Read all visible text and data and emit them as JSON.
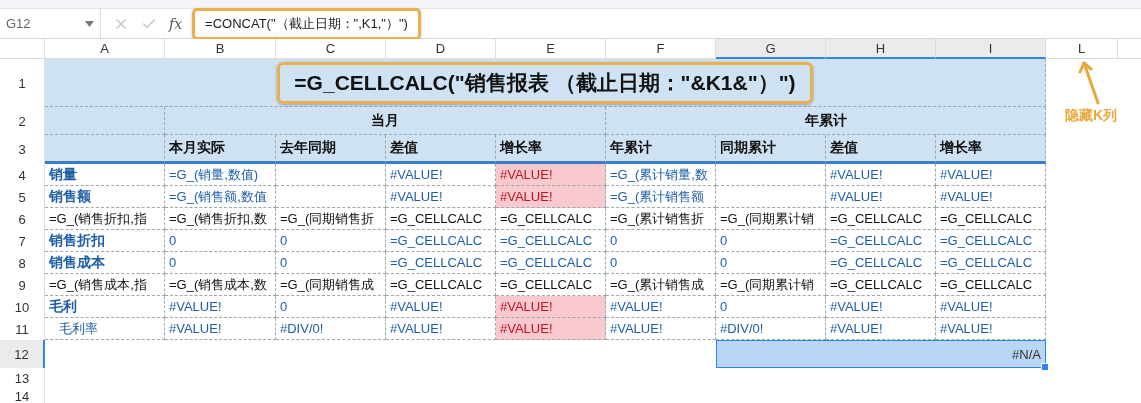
{
  "name_box": {
    "value": "G12"
  },
  "formula_bar": {
    "fx_label": "fx",
    "value": "=CONCAT(\"（截止日期：\",K1,\"）\")",
    "highlighted": true
  },
  "columns": [
    {
      "label": "A",
      "selected": false
    },
    {
      "label": "B",
      "selected": false
    },
    {
      "label": "C",
      "selected": false
    },
    {
      "label": "D",
      "selected": false
    },
    {
      "label": "E",
      "selected": false
    },
    {
      "label": "F",
      "selected": false
    },
    {
      "label": "G",
      "selected": true
    },
    {
      "label": "H",
      "selected": true
    },
    {
      "label": "I",
      "selected": true
    },
    {
      "label": "L",
      "selected": false
    }
  ],
  "row_labels": [
    {
      "label": "1",
      "selected": false
    },
    {
      "label": "2",
      "selected": false
    },
    {
      "label": "3",
      "selected": false
    },
    {
      "label": "4",
      "selected": false
    },
    {
      "label": "5",
      "selected": false
    },
    {
      "label": "6",
      "selected": false
    },
    {
      "label": "7",
      "selected": false
    },
    {
      "label": "8",
      "selected": false
    },
    {
      "label": "9",
      "selected": false
    },
    {
      "label": "10",
      "selected": false
    },
    {
      "label": "11",
      "selected": false
    },
    {
      "label": "12",
      "selected": true
    },
    {
      "label": "13",
      "selected": false
    },
    {
      "label": "14",
      "selected": false
    }
  ],
  "title": {
    "text": "=G_CELLCALC(\"销售报表 （截止日期：\"&K1&\"）\")",
    "highlighted": true
  },
  "groups": [
    {
      "label": "当月"
    },
    {
      "label": "年累计"
    }
  ],
  "subheaders": [
    "本月实际",
    "去年同期",
    "差值",
    "增长率",
    "年累计",
    "同期累计",
    "差值",
    "增长率"
  ],
  "rows": [
    {
      "cells": [
        {
          "text": "销量",
          "kind": "label"
        },
        {
          "text": "=G_(销量,数值)",
          "kind": "blue"
        },
        {
          "text": "",
          "kind": "blue"
        },
        {
          "text": "#VALUE!",
          "kind": "blue"
        },
        {
          "text": "#VALUE!",
          "kind": "error"
        },
        {
          "text": "=G_(累计销量,数",
          "kind": "blue"
        },
        {
          "text": "",
          "kind": "blue"
        },
        {
          "text": "#VALUE!",
          "kind": "blue"
        },
        {
          "text": "#VALUE!",
          "kind": "blue"
        }
      ]
    },
    {
      "cells": [
        {
          "text": "销售额",
          "kind": "label"
        },
        {
          "text": "=G_(销售额,数值",
          "kind": "blue"
        },
        {
          "text": "",
          "kind": "blue"
        },
        {
          "text": "#VALUE!",
          "kind": "blue"
        },
        {
          "text": "#VALUE!",
          "kind": "error"
        },
        {
          "text": "=G_(累计销售额",
          "kind": "blue"
        },
        {
          "text": "",
          "kind": "blue"
        },
        {
          "text": "#VALUE!",
          "kind": "blue"
        },
        {
          "text": "#VALUE!",
          "kind": "blue"
        }
      ]
    },
    {
      "cells": [
        {
          "text": "=G_(销售折扣,指",
          "kind": "black"
        },
        {
          "text": "=G_(销售折扣,数",
          "kind": "black"
        },
        {
          "text": "=G_(同期销售折",
          "kind": "black"
        },
        {
          "text": "=G_CELLCALC",
          "kind": "black"
        },
        {
          "text": "=G_CELLCALC",
          "kind": "black"
        },
        {
          "text": "=G_(累计销售折",
          "kind": "black"
        },
        {
          "text": "=G_(同期累计销",
          "kind": "black"
        },
        {
          "text": "=G_CELLCALC",
          "kind": "black"
        },
        {
          "text": "=G_CELLCALC",
          "kind": "black"
        }
      ]
    },
    {
      "cells": [
        {
          "text": "销售折扣",
          "kind": "label"
        },
        {
          "text": "0",
          "kind": "blue"
        },
        {
          "text": "0",
          "kind": "blue"
        },
        {
          "text": "=G_CELLCALC",
          "kind": "blue"
        },
        {
          "text": "=G_CELLCALC",
          "kind": "blue"
        },
        {
          "text": "0",
          "kind": "blue"
        },
        {
          "text": "0",
          "kind": "blue"
        },
        {
          "text": "=G_CELLCALC",
          "kind": "blue"
        },
        {
          "text": "=G_CELLCALC",
          "kind": "blue"
        }
      ]
    },
    {
      "cells": [
        {
          "text": "销售成本",
          "kind": "label"
        },
        {
          "text": "0",
          "kind": "blue"
        },
        {
          "text": "0",
          "kind": "blue"
        },
        {
          "text": "=G_CELLCALC",
          "kind": "blue"
        },
        {
          "text": "=G_CELLCALC",
          "kind": "blue"
        },
        {
          "text": "0",
          "kind": "blue"
        },
        {
          "text": "0",
          "kind": "blue"
        },
        {
          "text": "=G_CELLCALC",
          "kind": "blue"
        },
        {
          "text": "=G_CELLCALC",
          "kind": "blue"
        }
      ]
    },
    {
      "cells": [
        {
          "text": "=G_(销售成本,指",
          "kind": "black"
        },
        {
          "text": "=G_(销售成本,数",
          "kind": "black"
        },
        {
          "text": "=G_(同期销售成",
          "kind": "black"
        },
        {
          "text": "=G_CELLCALC",
          "kind": "black"
        },
        {
          "text": "=G_CELLCALC",
          "kind": "black"
        },
        {
          "text": "=G_(累计销售成",
          "kind": "black"
        },
        {
          "text": "=G_(同期累计销",
          "kind": "black"
        },
        {
          "text": "=G_CELLCALC",
          "kind": "black"
        },
        {
          "text": "=G_CELLCALC",
          "kind": "black"
        }
      ]
    },
    {
      "cells": [
        {
          "text": "毛利",
          "kind": "label"
        },
        {
          "text": "#VALUE!",
          "kind": "blue"
        },
        {
          "text": "0",
          "kind": "blue"
        },
        {
          "text": "#VALUE!",
          "kind": "blue"
        },
        {
          "text": "#VALUE!",
          "kind": "error"
        },
        {
          "text": "#VALUE!",
          "kind": "blue"
        },
        {
          "text": "0",
          "kind": "blue"
        },
        {
          "text": "#VALUE!",
          "kind": "blue"
        },
        {
          "text": "#VALUE!",
          "kind": "blue"
        }
      ]
    },
    {
      "cells": [
        {
          "text": "毛利率",
          "kind": "sublabel"
        },
        {
          "text": "#VALUE!",
          "kind": "blue"
        },
        {
          "text": "#DIV/0!",
          "kind": "blue"
        },
        {
          "text": "#VALUE!",
          "kind": "blue"
        },
        {
          "text": "#VALUE!",
          "kind": "error"
        },
        {
          "text": "#VALUE!",
          "kind": "blue"
        },
        {
          "text": "#DIV/0!",
          "kind": "blue"
        },
        {
          "text": "#VALUE!",
          "kind": "blue"
        },
        {
          "text": "#VALUE!",
          "kind": "blue"
        }
      ]
    }
  ],
  "selected_cell": {
    "value": "#N/A"
  },
  "annotation": {
    "text": "隐藏K列"
  }
}
